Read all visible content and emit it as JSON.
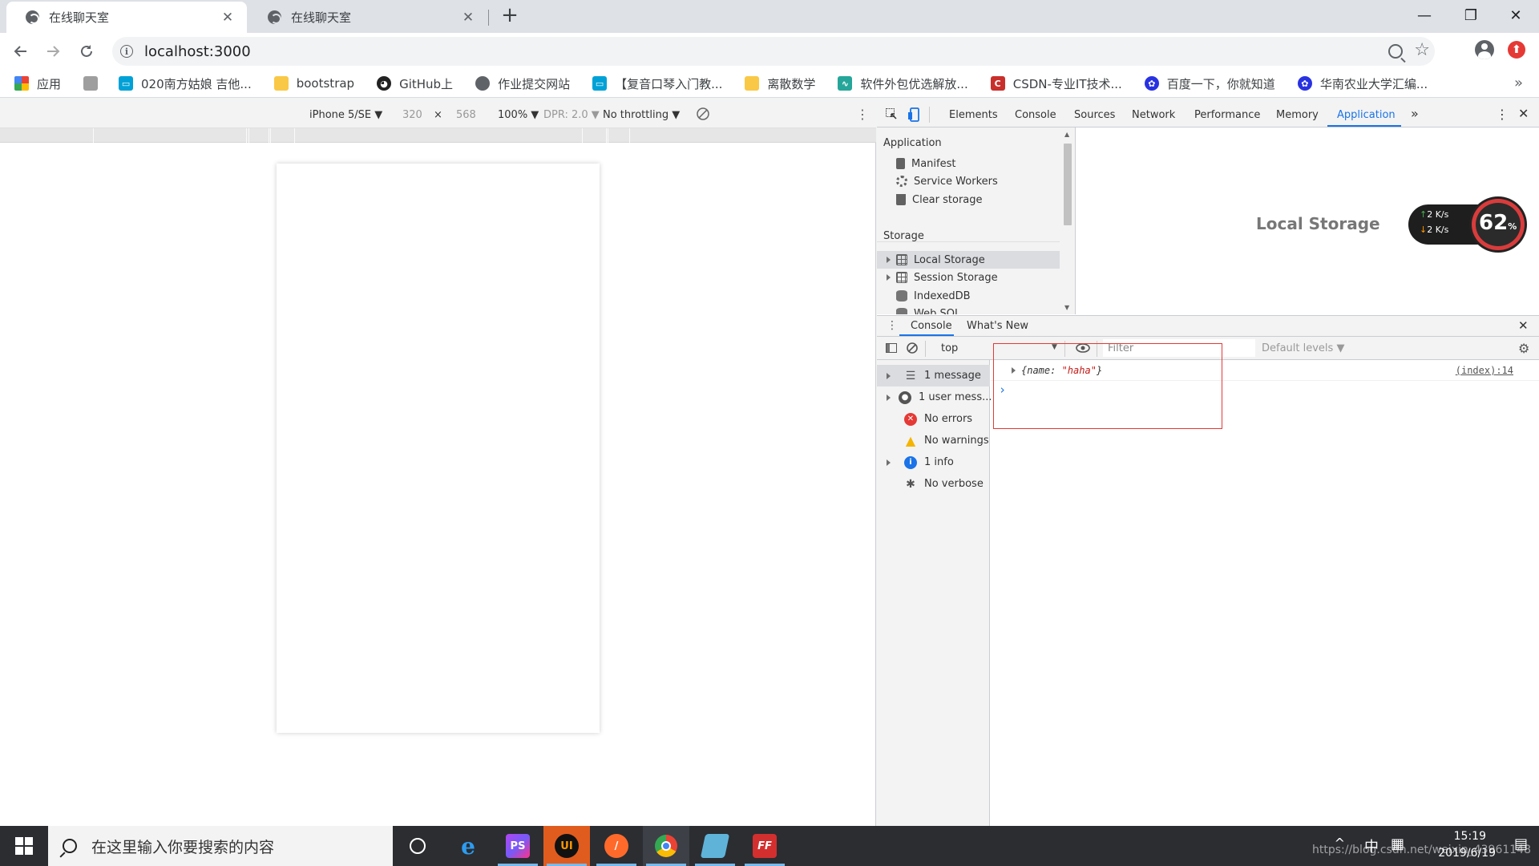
{
  "browser": {
    "tabs": [
      {
        "title": "在线聊天室",
        "close": "✕"
      },
      {
        "title": "在线聊天室",
        "close": "✕"
      }
    ],
    "new_tab": "+",
    "url": "localhost:3000",
    "window_controls": {
      "minimize": "—",
      "restore": "❐",
      "close": "✕"
    }
  },
  "bookmarks": [
    {
      "label": "应用",
      "icon": "apps-grid-icon"
    },
    {
      "label": "",
      "icon": "image-icon"
    },
    {
      "label": "020南方姑娘 吉他...",
      "icon": "bilibili-icon"
    },
    {
      "label": "bootstrap",
      "icon": "folder-icon"
    },
    {
      "label": "GitHub上",
      "icon": "github-icon"
    },
    {
      "label": "作业提交网站",
      "icon": "globe-icon"
    },
    {
      "label": "【复音口琴入门教...",
      "icon": "bilibili-icon"
    },
    {
      "label": "离散数学",
      "icon": "folder-icon"
    },
    {
      "label": "软件外包优选解放...",
      "icon": "chart-icon"
    },
    {
      "label": "CSDN-专业IT技术...",
      "icon": "csdn-icon"
    },
    {
      "label": "百度一下，你就知道",
      "icon": "baidu-icon"
    },
    {
      "label": "华南农业大学汇编...",
      "icon": "baidu-icon"
    }
  ],
  "bookmarks_overflow": "»",
  "device_toolbar": {
    "device": "iPhone 5/SE ▼",
    "width": "320",
    "times": "×",
    "height": "568",
    "zoom": "100% ▼",
    "dpr": "DPR: 2.0 ▼",
    "throttling": "No throttling ▼"
  },
  "devtools": {
    "tabs": [
      "Elements",
      "Console",
      "Sources",
      "Network",
      "Performance",
      "Memory",
      "Application"
    ],
    "active_tab": "Application",
    "more": "»",
    "sidebar": {
      "application_header": "Application",
      "application_items": [
        "Manifest",
        "Service Workers",
        "Clear storage"
      ],
      "storage_header": "Storage",
      "storage_items": [
        "Local Storage",
        "Session Storage",
        "IndexedDB",
        "Web SQL"
      ]
    },
    "main_title": "Local Storage",
    "drawer_tabs": [
      "Console",
      "What's New"
    ],
    "console_toolbar": {
      "context": "top",
      "filter_placeholder": "Filter",
      "levels": "Default levels ▼"
    },
    "console_sidebar": [
      {
        "label": "1 message",
        "icon": "list-icon",
        "expandable": true
      },
      {
        "label": "1 user mess...",
        "icon": "user-icon",
        "expandable": true
      },
      {
        "label": "No errors",
        "icon": "error-icon",
        "expandable": false
      },
      {
        "label": "No warnings",
        "icon": "warning-icon",
        "expandable": false
      },
      {
        "label": "1 info",
        "icon": "info-icon",
        "expandable": true
      },
      {
        "label": "No verbose",
        "icon": "bug-icon",
        "expandable": false
      }
    ],
    "log": {
      "object_open": "{name: ",
      "object_value": "\"haha\"",
      "object_close": "}",
      "source": "(index):14",
      "prompt": "›"
    }
  },
  "speed_widget": {
    "up": "2 K/s",
    "down": "2 K/s",
    "percent": "62",
    "unit": "%"
  },
  "taskbar": {
    "search_text": "在这里输入你要搜索的内容",
    "apps": [
      "cortana-icon",
      "ie-icon",
      "phpstorm-icon",
      "ui-icon",
      "sublime-icon",
      "chrome-icon",
      "notepad-icon",
      "filezilla-icon"
    ],
    "time": "15:19",
    "date": "2019/6/19",
    "ime": "中",
    "watermark": "https://blog.csdn.net/weixin_43961148"
  },
  "colors": {
    "accent": "#1a73e8",
    "highlight_box": "#e53935",
    "taskbar": "#2b2d31"
  }
}
